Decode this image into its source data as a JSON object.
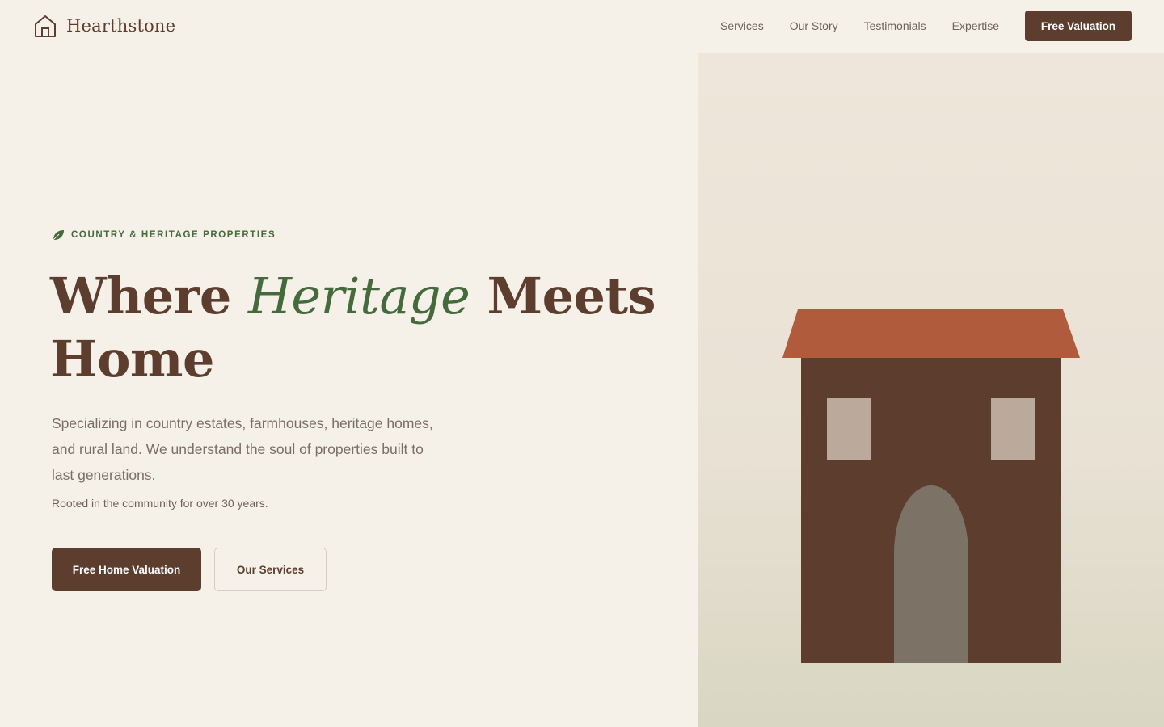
{
  "brand": {
    "name": "Hearthstone",
    "icon": "house-outline-icon"
  },
  "nav": {
    "links": [
      "Services",
      "Our Story",
      "Testimonials",
      "Expertise"
    ],
    "cta_label": "Free Valuation"
  },
  "hero": {
    "eyebrow_icon": "leaf-icon",
    "eyebrow": "COUNTRY & HERITAGE PROPERTIES",
    "headline_before": "Where ",
    "headline_accent": "Heritage",
    "headline_after": " Meets Home",
    "lead": "Specializing in country estates, farmhouses, heritage homes, and rural land. We understand the soul of properties built to last generations.",
    "note": "Rooted in the community for over 30 years.",
    "primary_label": "Free Home Valuation",
    "secondary_label": "Our Services"
  },
  "colors": {
    "background": "#f5f0e8",
    "primary_brown": "#5c3d2e",
    "accent_green": "#456a3c",
    "roof_terracotta": "#b05b3b",
    "window": "#bba99b",
    "door": "#7d7266"
  }
}
